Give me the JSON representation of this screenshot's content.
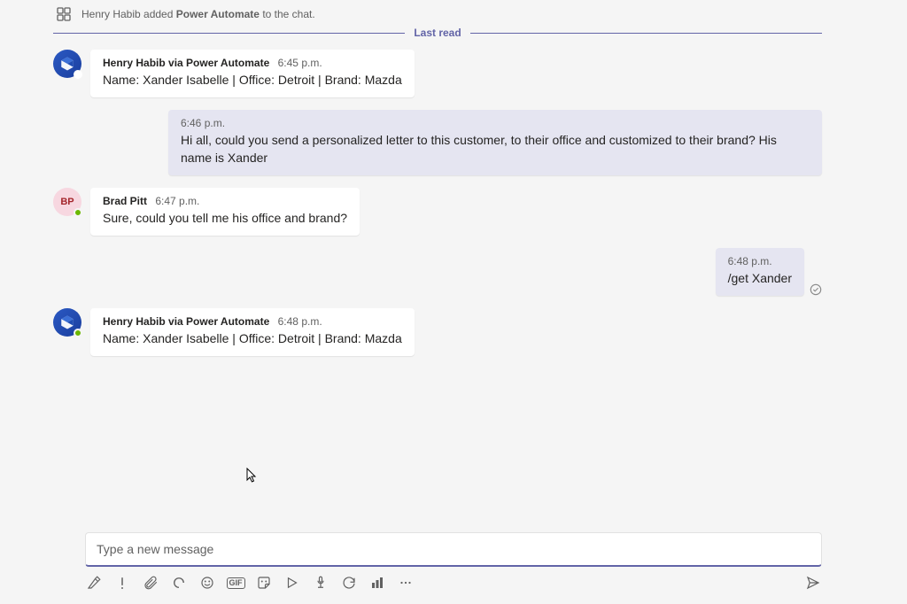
{
  "system": {
    "text_before": "Henry Habib added ",
    "bold": "Power Automate",
    "text_after": " to the chat."
  },
  "last_read": "Last read",
  "messages": [
    {
      "type": "other",
      "avatar": "pa",
      "sender": "Henry Habib via Power Automate",
      "time": "6:45 p.m.",
      "content": "Name: Xander Isabelle | Office: Detroit | Brand: Mazda"
    },
    {
      "type": "self_wide",
      "time": "6:46 p.m.",
      "content": "Hi all, could you send a personalized letter to this customer, to their office and customized to their brand? His name is Xander"
    },
    {
      "type": "other",
      "avatar": "initials",
      "initials": "BP",
      "sender": "Brad Pitt",
      "time": "6:47 p.m.",
      "content": "Sure, could you tell me his office and brand?"
    },
    {
      "type": "self",
      "time": "6:48 p.m.",
      "content": "/get Xander"
    },
    {
      "type": "other",
      "avatar": "pa",
      "sender": "Henry Habib via Power Automate",
      "time": "6:48 p.m.",
      "content": "Name: Xander Isabelle | Office: Detroit | Brand: Mazda"
    }
  ],
  "compose": {
    "placeholder": "Type a new message"
  },
  "toolbar": {
    "gif": "GIF"
  }
}
